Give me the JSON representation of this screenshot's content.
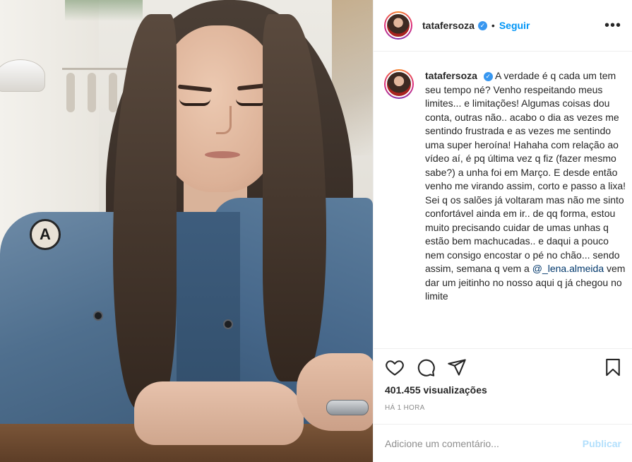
{
  "post": {
    "username": "tatafersoza",
    "verified_icon": "verified-badge-icon",
    "separator": "•",
    "follow_label": "Seguir",
    "more_label": "•••",
    "caption": {
      "username": "tatafersoza",
      "text": "A verdade é q cada um tem seu tempo né? Venho respeitando meus limites... e limitações! Algumas coisas dou conta, outras não.. acabo o dia as vezes me sentindo frustrada e as vezes me sentindo uma super heroína! Hahaha com relação ao vídeo aí, é pq última vez q fiz (fazer mesmo sabe?) a unha foi em Março. E desde então venho me virando assim, corto e passo a lixa! Sei q os salões já voltaram mas não me sinto confortável ainda em ir.. de qq forma, estou muito precisando cuidar de umas unhas q estão bem machucadas.. e daqui a pouco nem consigo encostar o pé no chão... sendo assim, semana q vem a",
      "mention": "@_lena.almeida",
      "text_after": " vem dar um jeitinho no nosso aqui q já chegou no limite"
    },
    "views": "401.455 visualizações",
    "time": "HÁ 1 HORA",
    "comment_placeholder": "Adicione um comentário...",
    "publish_label": "Publicar"
  },
  "icons": {
    "like": "heart-icon",
    "comment": "comment-icon",
    "share": "share-icon",
    "save": "bookmark-icon"
  },
  "colors": {
    "accent": "#0095f6",
    "verified": "#3897f0",
    "publish_disabled": "#b2dffc",
    "muted": "#8e8e8e"
  }
}
